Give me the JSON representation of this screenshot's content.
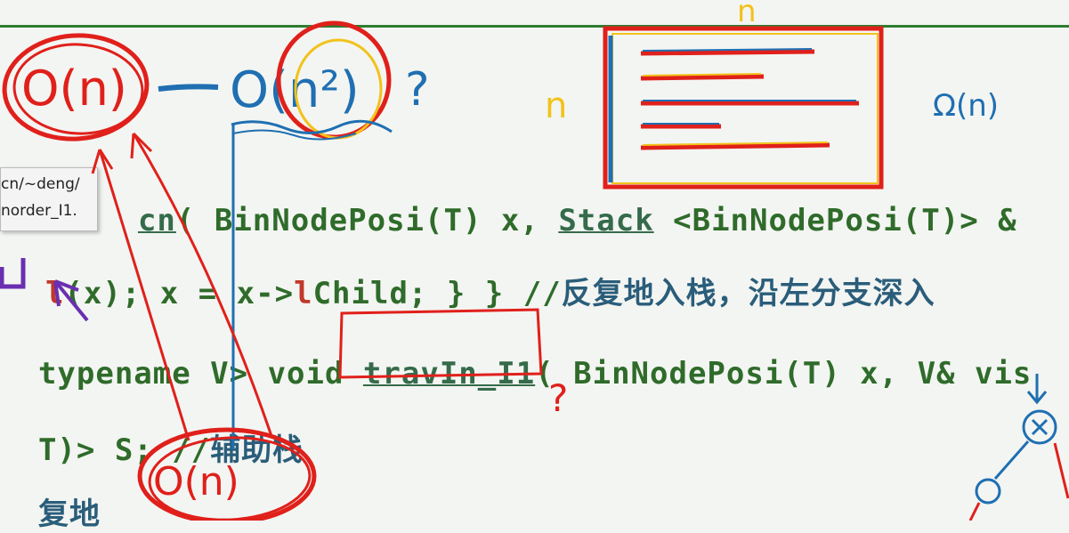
{
  "tooltip": {
    "line1": "cn/~deng/",
    "line2": "norder_I1."
  },
  "code": {
    "line1_fn": "cn",
    "line1_rest": "( BinNodePosi(T) x, ",
    "line1_stack": "Stack",
    "line1_tail": " <BinNodePosi(T)> &",
    "line2_red": "l",
    "line2_code": "(x); x = x->",
    "line2_lchild_l": "l",
    "line2_lchild": "Child; } } //",
    "line2_comment": "反复地入栈，沿左分支深入",
    "line3_pre": "typename V> void ",
    "line3_fn": "travIn_I1",
    "line3_post": "( BinNodePosi(T) x, V& vis",
    "line4_code": "T)> S; //",
    "line4_comment": "辅助栈",
    "line5_comment": "复地"
  },
  "annotations": {
    "big_o_n_left": "O(n)",
    "big_o_n2": "O(n²)",
    "question1": "?",
    "n_top": "n",
    "n_left": "n",
    "omega_n": "Ω(n)",
    "question2": "?",
    "big_o_n_bottom": "O(n)",
    "colors": {
      "red_ink": "#e0201b",
      "blue_ink": "#1f6fb2",
      "yellow_ink": "#f2c21b",
      "purple_ink": "#6a2fb0",
      "code_green": "#2f6b2a"
    }
  }
}
